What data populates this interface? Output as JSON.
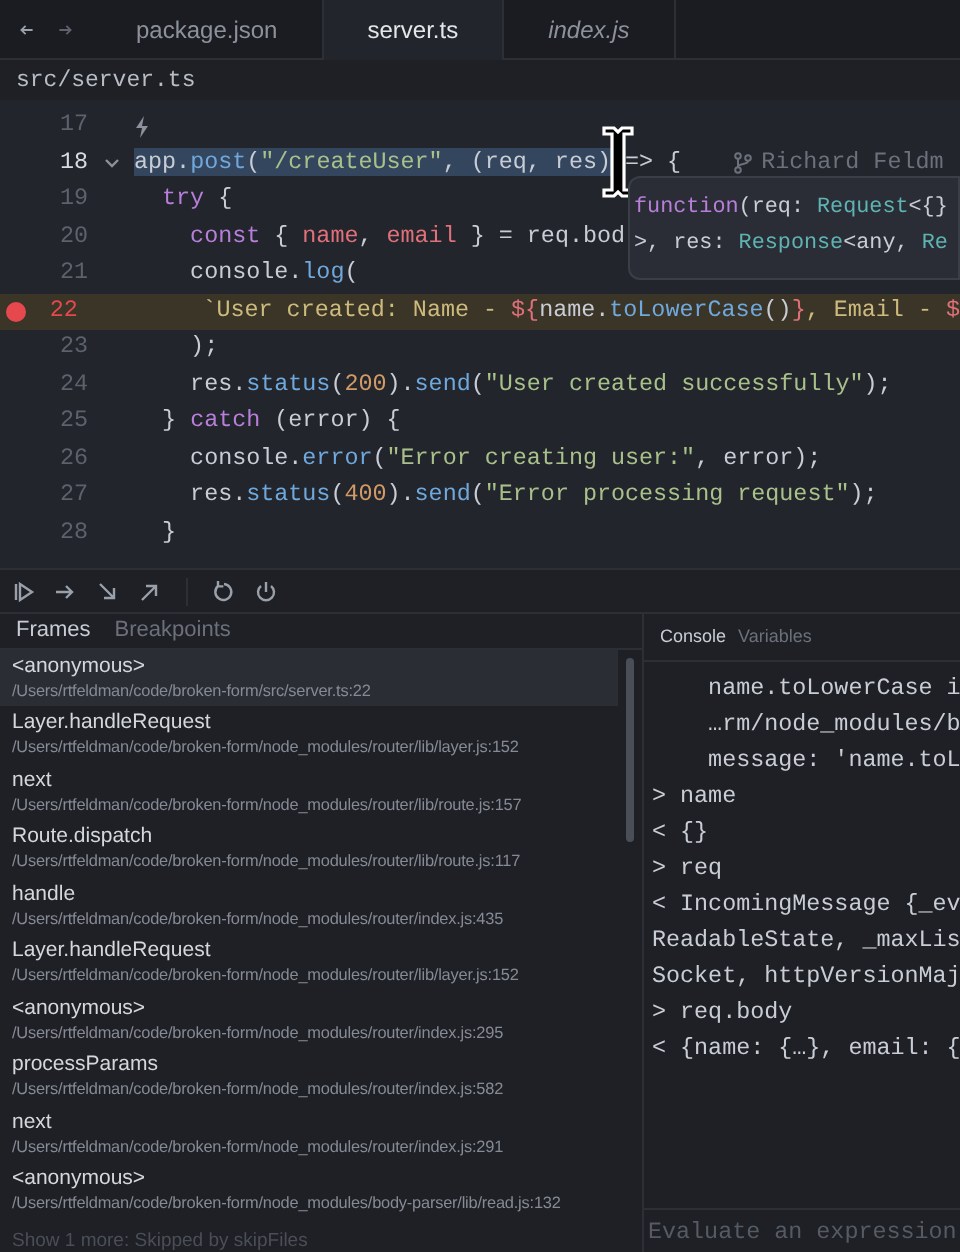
{
  "tabs": [
    {
      "label": "package.json",
      "selected": false,
      "preview": false
    },
    {
      "label": "server.ts",
      "selected": true,
      "preview": false
    },
    {
      "label": "index.js",
      "selected": false,
      "preview": true
    }
  ],
  "breadcrumb": "src/server.ts",
  "editor": {
    "lines": [
      {
        "number": "17",
        "current": false,
        "breakpoint": false,
        "code_lens": true
      },
      {
        "number": "18",
        "current": true,
        "breakpoint": false,
        "foldable": true,
        "tokens": [
          {
            "text": "app",
            "kind": "plain",
            "selected": true
          },
          {
            "text": ".",
            "kind": "plain",
            "selected": true
          },
          {
            "text": "post",
            "kind": "fn",
            "selected": true
          },
          {
            "text": "(",
            "kind": "plain",
            "selected": true
          },
          {
            "text": "\"/createUser\"",
            "kind": "string",
            "selected": true
          },
          {
            "text": ", (req, res)",
            "kind": "plain",
            "selected": true
          },
          {
            "text": " => {",
            "kind": "plain",
            "selected": false
          }
        ]
      },
      {
        "number": "19",
        "current": false,
        "breakpoint": false,
        "tokens": [
          {
            "text": "  try",
            "kind": "keyword"
          },
          {
            "text": " {",
            "kind": "plain"
          }
        ]
      },
      {
        "number": "20",
        "current": false,
        "breakpoint": false,
        "tokens": [
          {
            "text": "    const",
            "kind": "keyword"
          },
          {
            "text": " { ",
            "kind": "plain"
          },
          {
            "text": "name",
            "kind": "var"
          },
          {
            "text": ", ",
            "kind": "plain"
          },
          {
            "text": "email",
            "kind": "var"
          },
          {
            "text": " } = req.bod",
            "kind": "plain"
          }
        ]
      },
      {
        "number": "21",
        "current": false,
        "breakpoint": false,
        "tokens": [
          {
            "text": "    console.",
            "kind": "plain"
          },
          {
            "text": "log",
            "kind": "fn"
          },
          {
            "text": "(",
            "kind": "plain"
          }
        ]
      },
      {
        "number": "22",
        "current": false,
        "breakpoint": true,
        "tokens": [
          {
            "text": "      `User created: Name - ",
            "kind": "template"
          },
          {
            "text": "${",
            "kind": "var"
          },
          {
            "text": "name.",
            "kind": "plain"
          },
          {
            "text": "toLowerCase",
            "kind": "fn"
          },
          {
            "text": "()",
            "kind": "plain"
          },
          {
            "text": "}",
            "kind": "var"
          },
          {
            "text": ", Email - ",
            "kind": "template"
          },
          {
            "text": "$",
            "kind": "var"
          }
        ]
      },
      {
        "number": "23",
        "current": false,
        "breakpoint": false,
        "tokens": [
          {
            "text": "    );",
            "kind": "plain"
          }
        ]
      },
      {
        "number": "24",
        "current": false,
        "breakpoint": false,
        "tokens": [
          {
            "text": "    res.",
            "kind": "plain"
          },
          {
            "text": "status",
            "kind": "fn"
          },
          {
            "text": "(",
            "kind": "plain"
          },
          {
            "text": "200",
            "kind": "number"
          },
          {
            "text": ").",
            "kind": "plain"
          },
          {
            "text": "send",
            "kind": "fn"
          },
          {
            "text": "(",
            "kind": "plain"
          },
          {
            "text": "\"User created successfully\"",
            "kind": "string"
          },
          {
            "text": ");",
            "kind": "plain"
          }
        ]
      },
      {
        "number": "25",
        "current": false,
        "breakpoint": false,
        "tokens": [
          {
            "text": "  } ",
            "kind": "plain"
          },
          {
            "text": "catch",
            "kind": "keyword"
          },
          {
            "text": " (error) {",
            "kind": "plain"
          }
        ]
      },
      {
        "number": "26",
        "current": false,
        "breakpoint": false,
        "tokens": [
          {
            "text": "    console.",
            "kind": "plain"
          },
          {
            "text": "error",
            "kind": "fn"
          },
          {
            "text": "(",
            "kind": "plain"
          },
          {
            "text": "\"Error creating user:\"",
            "kind": "string"
          },
          {
            "text": ", error);",
            "kind": "plain"
          }
        ]
      },
      {
        "number": "27",
        "current": false,
        "breakpoint": false,
        "tokens": [
          {
            "text": "    res.",
            "kind": "plain"
          },
          {
            "text": "status",
            "kind": "fn"
          },
          {
            "text": "(",
            "kind": "plain"
          },
          {
            "text": "400",
            "kind": "number"
          },
          {
            "text": ").",
            "kind": "plain"
          },
          {
            "text": "send",
            "kind": "fn"
          },
          {
            "text": "(",
            "kind": "plain"
          },
          {
            "text": "\"Error processing request\"",
            "kind": "string"
          },
          {
            "text": ");",
            "kind": "plain"
          }
        ]
      },
      {
        "number": "28",
        "current": false,
        "breakpoint": false,
        "tokens": [
          {
            "text": "  }",
            "kind": "plain"
          }
        ]
      }
    ],
    "blame": "Richard Feldm",
    "tooltip": [
      [
        {
          "text": "function",
          "kind": "keyword"
        },
        {
          "text": "(req: ",
          "kind": "plain"
        },
        {
          "text": "Request",
          "kind": "type"
        },
        {
          "text": "<{}",
          "kind": "plain"
        }
      ],
      [
        {
          "text": ">, res: ",
          "kind": "plain"
        },
        {
          "text": "Response",
          "kind": "type"
        },
        {
          "text": "<any, ",
          "kind": "plain"
        },
        {
          "text": "Re",
          "kind": "type"
        }
      ]
    ]
  },
  "frames_panel": {
    "tabs": [
      {
        "label": "Frames",
        "selected": true
      },
      {
        "label": "Breakpoints",
        "selected": false
      }
    ],
    "frames": [
      {
        "function": "<anonymous>",
        "location": "/Users/rtfeldman/code/broken-form/src/server.ts:22",
        "selected": true
      },
      {
        "function": "Layer.handleRequest",
        "location": "/Users/rtfeldman/code/broken-form/node_modules/router/lib/layer.js:152",
        "selected": false
      },
      {
        "function": "next",
        "location": "/Users/rtfeldman/code/broken-form/node_modules/router/lib/route.js:157",
        "selected": false
      },
      {
        "function": "Route.dispatch",
        "location": "/Users/rtfeldman/code/broken-form/node_modules/router/lib/route.js:117",
        "selected": false
      },
      {
        "function": "handle",
        "location": "/Users/rtfeldman/code/broken-form/node_modules/router/index.js:435",
        "selected": false
      },
      {
        "function": "Layer.handleRequest",
        "location": "/Users/rtfeldman/code/broken-form/node_modules/router/lib/layer.js:152",
        "selected": false
      },
      {
        "function": "<anonymous>",
        "location": "/Users/rtfeldman/code/broken-form/node_modules/router/index.js:295",
        "selected": false
      },
      {
        "function": "processParams",
        "location": "/Users/rtfeldman/code/broken-form/node_modules/router/index.js:582",
        "selected": false
      },
      {
        "function": "next",
        "location": "/Users/rtfeldman/code/broken-form/node_modules/router/index.js:291",
        "selected": false
      },
      {
        "function": "<anonymous>",
        "location": "/Users/rtfeldman/code/broken-form/node_modules/body-parser/lib/read.js:132",
        "selected": false
      }
    ],
    "more": "Show 1 more: Skipped by skipFiles"
  },
  "console_panel": {
    "tabs": [
      {
        "label": "Console",
        "selected": true
      },
      {
        "label": "Variables",
        "selected": false
      }
    ],
    "lines": [
      "    name.toLowerCase i",
      "    …rm/node_modules/b",
      "    message: 'name.toL",
      "> name",
      "< {}",
      "> req",
      "< IncomingMessage {_ev",
      "ReadableState, _maxLis",
      "Socket, httpVersionMaj",
      "> req.body",
      "< {name: {…}, email: {"
    ],
    "input": {
      "placeholder": "Evaluate an expression"
    }
  }
}
